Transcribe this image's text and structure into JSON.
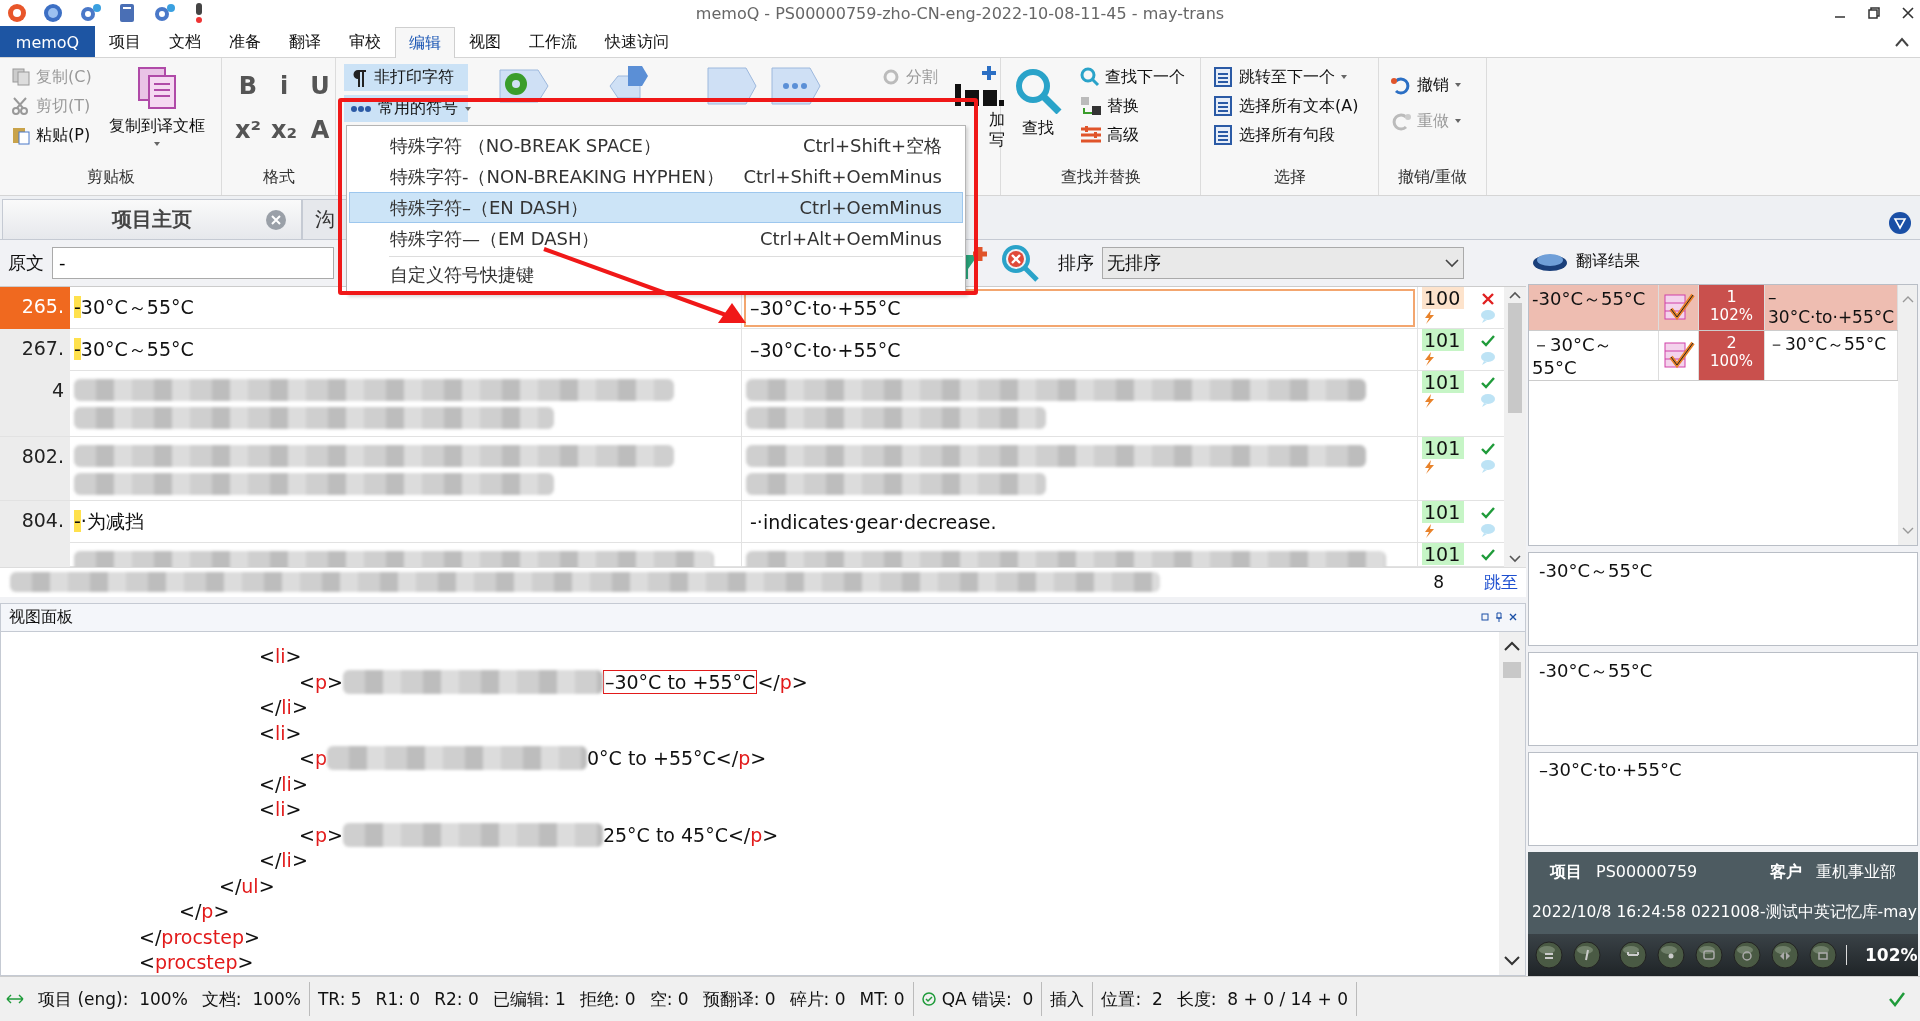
{
  "window": {
    "title": "memoQ - PS00000759-zho-CN-eng-2022-10-08-11-45 - may-trans"
  },
  "ribbon_tabs": [
    {
      "label": "memoQ",
      "kind": "app",
      "selected": false
    },
    {
      "label": "项目",
      "kind": "tab",
      "selected": false
    },
    {
      "label": "文档",
      "kind": "tab",
      "selected": false
    },
    {
      "label": "准备",
      "kind": "tab",
      "selected": false
    },
    {
      "label": "翻译",
      "kind": "tab",
      "selected": false
    },
    {
      "label": "审校",
      "kind": "tab",
      "selected": false
    },
    {
      "label": "编辑",
      "kind": "tab",
      "selected": true
    },
    {
      "label": "视图",
      "kind": "tab",
      "selected": false
    },
    {
      "label": "工作流",
      "kind": "tab",
      "selected": false
    },
    {
      "label": "快速访问",
      "kind": "tab",
      "selected": false
    }
  ],
  "ribbon_groups": [
    {
      "kind": "clipboard",
      "label": "剪贴板",
      "small_buttons": [
        {
          "label": "复制(C)",
          "disabled": true
        },
        {
          "label": "剪切(T)",
          "disabled": true
        },
        {
          "label": "粘贴(P)",
          "disabled": false
        }
      ],
      "large_button": {
        "label": "复制到译文框"
      }
    },
    {
      "kind": "format",
      "label": "格式",
      "buttons": [
        "B",
        "i",
        "U",
        "x²",
        "x₂",
        "A"
      ]
    },
    {
      "kind": "insert",
      "toggles": [
        {
          "label": "非打印字符",
          "on": true
        },
        {
          "label": "常用的符号",
          "on": true
        }
      ],
      "split": {
        "label": "分割",
        "disabled": true
      },
      "cut_labels": [
        "加",
        "写"
      ]
    },
    {
      "kind": "find",
      "label": "查找并替换",
      "large_button": {
        "label": "查找"
      },
      "small_buttons": [
        {
          "label": "查找下一个",
          "disabled": false
        },
        {
          "label": "替换",
          "disabled": false
        },
        {
          "label": "高级",
          "disabled": false
        }
      ]
    },
    {
      "kind": "select",
      "label": "选择",
      "small_buttons": [
        {
          "label": "跳转至下一个",
          "disabled": false
        },
        {
          "label": "选择所有文本(A)",
          "disabled": false
        },
        {
          "label": "选择所有句段",
          "disabled": false
        }
      ]
    },
    {
      "kind": "undo",
      "label": "撤销/重做",
      "small_buttons": [
        {
          "label": "撤销",
          "disabled": false
        },
        {
          "label": "重做",
          "disabled": true
        }
      ]
    }
  ],
  "symbol_menu": {
    "items": [
      {
        "kind": "symbol",
        "label": "特殊字符 （NO-BREAK SPACE）",
        "shortcut": "Ctrl+Shift+空格",
        "selected": false
      },
      {
        "kind": "symbol",
        "label": "特殊字符-（NON-BREAKING HYPHEN）",
        "shortcut": "Ctrl+Shift+OemMinus",
        "selected": false
      },
      {
        "kind": "symbol",
        "label": "特殊字符–（EN DASH）",
        "shortcut": "Ctrl+OemMinus",
        "selected": true
      },
      {
        "kind": "symbol",
        "label": "特殊字符—（EM DASH）",
        "shortcut": "Ctrl+Alt+OemMinus",
        "selected": false
      },
      {
        "kind": "custom",
        "label": "自定义符号快捷键",
        "selected": false
      }
    ]
  },
  "doc_tabs": [
    {
      "label": "项目主页",
      "selected": true,
      "closable": true
    },
    {
      "label": "沟",
      "selected": false,
      "closable": false
    }
  ],
  "filter": {
    "label": "原文",
    "value": "-",
    "sort_label": "排序",
    "sort_value": "无排序"
  },
  "segments": [
    {
      "kind": "text",
      "number": "265.",
      "match": "-",
      "source": "30°C～55°C",
      "target": "–30°C·to·+55°C",
      "score": "100",
      "color": "#fde3cc",
      "confirmed": false,
      "selected": true
    },
    {
      "kind": "text",
      "number": "267.",
      "match": "-",
      "source": "30°C～55°C",
      "target": "–30°C·to·+55°C",
      "score": "101",
      "color": "#c6f5c6",
      "confirmed": true,
      "selected": false
    },
    {
      "kind": "redacted",
      "number": "4",
      "score": "101",
      "color": "#c6f5c6",
      "confirmed": true,
      "selected": false
    },
    {
      "kind": "redacted",
      "number": "802.",
      "score": "101",
      "color": "#c6f5c6",
      "confirmed": true,
      "selected": false
    },
    {
      "kind": "text",
      "number": "804.",
      "match": "-",
      "source": "·为减挡",
      "target": "-·indicates·gear·decrease.",
      "score": "101",
      "color": "#c6f5c6",
      "confirmed": true,
      "selected": false
    },
    {
      "kind": "redacted_partial",
      "score": "101",
      "color": "#c6f5c6",
      "confirmed": true,
      "selected": false
    }
  ],
  "grid_footer": {
    "count": "8",
    "jump_link": "跳至"
  },
  "results_panel": {
    "title": "翻译结果",
    "results": [
      {
        "source": "-30°C～55°C",
        "rank": "1",
        "percent": "102%",
        "target": "–30°C·to·+55°C",
        "selected": true
      },
      {
        "source": "－30°C～55°C",
        "rank": "2",
        "percent": "100%",
        "target": "－30°C～55°C",
        "selected": false
      }
    ],
    "previews": [
      "-30°C～55°C",
      "-30°C～55°C",
      "–30°C·to·+55°C"
    ],
    "info": {
      "project_label": "项目",
      "project": "PS00000759",
      "client_label": "客户",
      "client": "重机事业部",
      "meta": "2022/10/8 16:24:58 0221008-测试中英记忆库-may",
      "zoom": "102%"
    }
  },
  "view_panel": {
    "title": "视图面板",
    "code": [
      {
        "children": [
          {
            "children": [
              {
                "children": [
                  {
                    "parts": [
                      {
                        "kind": "punct",
                        "text": "<"
                      },
                      {
                        "kind": "tag",
                        "text": "li"
                      },
                      {
                        "kind": "punct",
                        "text": ">"
                      }
                    ]
                  },
                  {
                    "children": [
                      {
                        "parts": [
                          {
                            "kind": "punct",
                            "text": "<"
                          },
                          {
                            "kind": "tag",
                            "text": "p"
                          },
                          {
                            "kind": "punct",
                            "text": ">"
                          },
                          {
                            "kind": "redacted"
                          },
                          {
                            "kind": "found",
                            "text": "–30°C to +55°C"
                          },
                          {
                            "kind": "punct",
                            "text": "</"
                          },
                          {
                            "kind": "tag",
                            "text": "p"
                          },
                          {
                            "kind": "punct",
                            "text": ">"
                          }
                        ]
                      }
                    ]
                  },
                  {
                    "parts": [
                      {
                        "kind": "punct",
                        "text": "</"
                      },
                      {
                        "kind": "tag",
                        "text": "li"
                      },
                      {
                        "kind": "punct",
                        "text": ">"
                      }
                    ]
                  },
                  {
                    "parts": [
                      {
                        "kind": "punct",
                        "text": "<"
                      },
                      {
                        "kind": "tag",
                        "text": "li"
                      },
                      {
                        "kind": "punct",
                        "text": ">"
                      }
                    ]
                  },
                  {
                    "children": [
                      {
                        "parts": [
                          {
                            "kind": "punct",
                            "text": "<"
                          },
                          {
                            "kind": "tag",
                            "text": "p"
                          },
                          {
                            "kind": "redacted"
                          },
                          {
                            "kind": "text",
                            "text": "0°C to +55°C"
                          },
                          {
                            "kind": "punct",
                            "text": "</"
                          },
                          {
                            "kind": "tag",
                            "text": "p"
                          },
                          {
                            "kind": "punct",
                            "text": ">"
                          }
                        ]
                      }
                    ]
                  },
                  {
                    "parts": [
                      {
                        "kind": "punct",
                        "text": "</"
                      },
                      {
                        "kind": "tag",
                        "text": "li"
                      },
                      {
                        "kind": "punct",
                        "text": ">"
                      }
                    ]
                  },
                  {
                    "parts": [
                      {
                        "kind": "punct",
                        "text": "<"
                      },
                      {
                        "kind": "tag",
                        "text": "li"
                      },
                      {
                        "kind": "punct",
                        "text": ">"
                      }
                    ]
                  },
                  {
                    "children": [
                      {
                        "parts": [
                          {
                            "kind": "punct",
                            "text": "<"
                          },
                          {
                            "kind": "tag",
                            "text": "p"
                          },
                          {
                            "kind": "punct",
                            "text": ">"
                          },
                          {
                            "kind": "redacted"
                          },
                          {
                            "kind": "text",
                            "text": "25°C to 45°C"
                          },
                          {
                            "kind": "punct",
                            "text": "</"
                          },
                          {
                            "kind": "tag",
                            "text": "p"
                          },
                          {
                            "kind": "punct",
                            "text": ">"
                          }
                        ]
                      }
                    ]
                  },
                  {
                    "parts": [
                      {
                        "kind": "punct",
                        "text": "</"
                      },
                      {
                        "kind": "tag",
                        "text": "li"
                      },
                      {
                        "kind": "punct",
                        "text": ">"
                      }
                    ]
                  }
                ]
              },
              {
                "parts": [
                  {
                    "kind": "punct",
                    "text": "</"
                  },
                  {
                    "kind": "tag",
                    "text": "ul"
                  },
                  {
                    "kind": "punct",
                    "text": ">"
                  }
                ]
              }
            ]
          },
          {
            "parts": [
              {
                "kind": "punct",
                "text": "</"
              },
              {
                "kind": "tag",
                "text": "p"
              },
              {
                "kind": "punct",
                "text": ">"
              }
            ]
          }
        ]
      },
      {
        "parts": [
          {
            "kind": "punct",
            "text": "</"
          },
          {
            "kind": "tag",
            "text": "procstep"
          },
          {
            "kind": "punct",
            "text": ">"
          }
        ]
      },
      {
        "parts": [
          {
            "kind": "punct",
            "text": "<"
          },
          {
            "kind": "tag",
            "text": "procstep"
          },
          {
            "kind": "punct",
            "text": ">"
          }
        ]
      }
    ]
  },
  "status_bar": {
    "groups": [
      {
        "items": [
          "项目 (eng):  100%",
          "文档:  100%"
        ]
      },
      {
        "items": [
          "TR: 5",
          "R1: 0",
          "R2: 0",
          "已编辑: 1",
          "拒绝: 0",
          "空: 0",
          "预翻译: 0",
          "碎片: 0",
          "MT: 0"
        ]
      },
      {
        "kind": "qa",
        "items": [
          "QA 错误:  0"
        ]
      },
      {
        "items": [
          "插入"
        ]
      },
      {
        "items": [
          "位置:  2",
          "长度:  8 + 0 / 14 + 0"
        ]
      }
    ]
  }
}
